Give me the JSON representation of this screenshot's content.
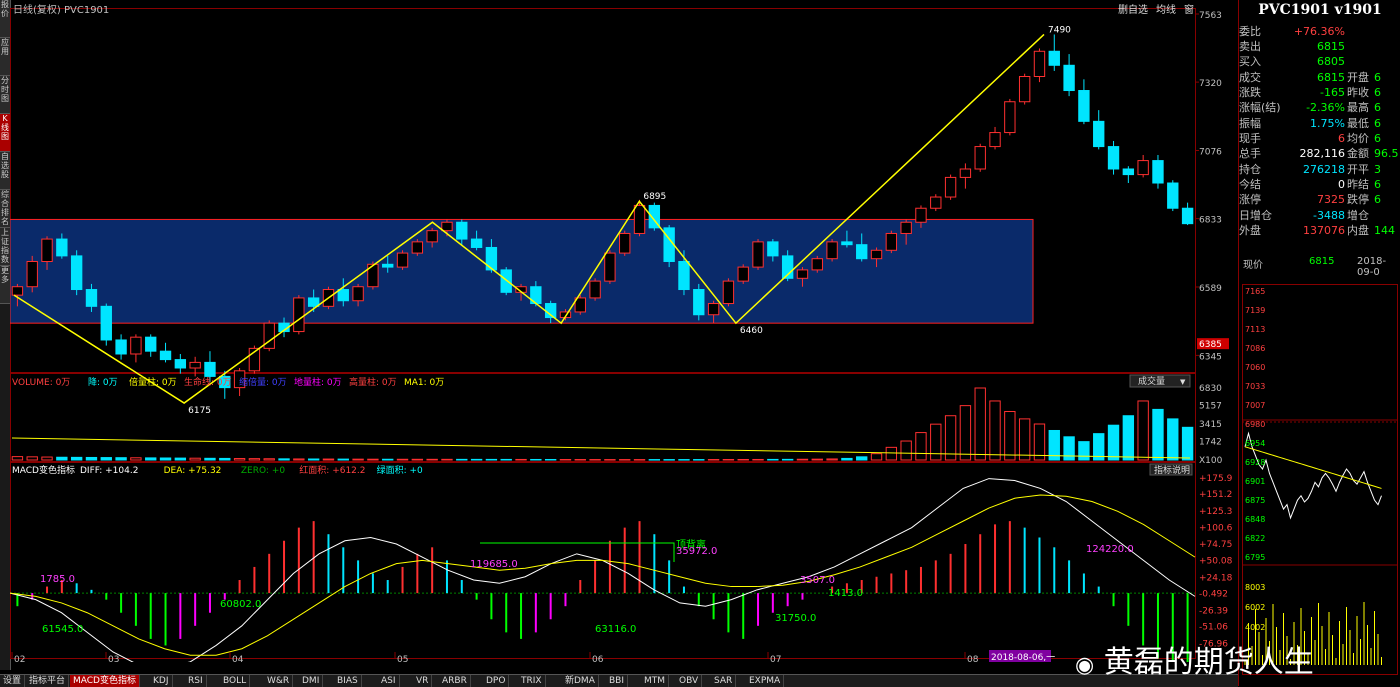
{
  "window": {
    "title": "日线(复权)  PVC1901"
  },
  "toolbar": {
    "items": [
      "删自选",
      "均线",
      "窗"
    ]
  },
  "left_tabs": [
    "报价",
    "应用",
    "分时图",
    "K线图",
    "自选股",
    "综合排名",
    "上证指数",
    "更多"
  ],
  "left_active": 3,
  "bottom_tabs": [
    "设置",
    "指标平台",
    "MACD变色指标",
    "KDJ",
    "RSI",
    "BOLL",
    "W&R",
    "DMI",
    "BIAS",
    "ASI",
    "VR",
    "ARBR",
    "DPO",
    "TRIX",
    "新DMA",
    "BBI",
    "MTM",
    "OBV",
    "SAR",
    "EXPMA"
  ],
  "bottom_active": 2,
  "date_marker": "2018-08-06,一",
  "x_month_labels": [
    "02",
    "03",
    "04",
    "05",
    "06",
    "07",
    "08"
  ],
  "main_price_labels": [
    "7563",
    "7320",
    "7076",
    "6833",
    "6589",
    "6345"
  ],
  "current_price_tag": "6385",
  "volume_panel": {
    "legend": [
      "VOLUME: 0万",
      "降: 0万",
      "倍量柱: 0万",
      "生命线: 0万",
      "缩倍量: 0万",
      "地量柱: 0万",
      "高量柱: 0万",
      "MA1: 0万"
    ],
    "legend_colors": [
      "#ff4040",
      "#00ffff",
      "#ffff00",
      "#ff4040",
      "#4040ff",
      "#ff00ff",
      "#ff4040",
      "#ffff00"
    ],
    "dropdown": "成交量",
    "y_labels": [
      "6830",
      "5157",
      "3415",
      "1742",
      "X100"
    ]
  },
  "macd_panel": {
    "title": "MACD变色指标",
    "legend": [
      "DIFF: +104.2",
      "DEA: +75.32",
      "ZERO: +0",
      "红面积: +612.2",
      "绿面积: +0"
    ],
    "legend_colors": [
      "#ffffff",
      "#ffff00",
      "#00aa00",
      "#ff4040",
      "#00ffff"
    ],
    "help_button": "指标说明",
    "y_labels": [
      "+175.9",
      "+151.2",
      "+125.3",
      "+100.6",
      "+74.75",
      "+50.08",
      "+24.18",
      "-0.492",
      "-26.39",
      "-51.06",
      "-76.96"
    ],
    "annotations": [
      "1785.0",
      "61545.0",
      "60802.0",
      "119685.0",
      "顶背离",
      "35972.0",
      "63116.0",
      "31750.0",
      "3507.0",
      "1413.0",
      "124220.0"
    ]
  },
  "chart_data": {
    "type": "candlestick",
    "title": "PVC1901 日线(复权)",
    "ylim": [
      6300,
      7563
    ],
    "x_months": [
      "02",
      "03",
      "04",
      "05",
      "06",
      "07",
      "08"
    ],
    "zigzag_points": [
      {
        "date_index": 0,
        "price": 6560
      },
      {
        "date_index": 37,
        "price": 6175
      },
      {
        "date_index": 91,
        "price": 6820
      },
      {
        "date_index": 119,
        "price": 6460
      },
      {
        "date_index": 136,
        "price": 6895
      },
      {
        "date_index": 157,
        "price": 6460
      },
      {
        "date_index": 224,
        "price": 7490
      }
    ],
    "pivot_labels": [
      "6175",
      "6895",
      "6460",
      "7490"
    ],
    "box_range": [
      6460,
      6830
    ],
    "candles": [
      [
        6560,
        6600,
        6520,
        6590
      ],
      [
        6590,
        6700,
        6570,
        6680
      ],
      [
        6680,
        6770,
        6650,
        6760
      ],
      [
        6760,
        6780,
        6690,
        6700
      ],
      [
        6700,
        6720,
        6560,
        6580
      ],
      [
        6580,
        6600,
        6500,
        6520
      ],
      [
        6520,
        6530,
        6380,
        6400
      ],
      [
        6400,
        6420,
        6330,
        6350
      ],
      [
        6350,
        6420,
        6320,
        6410
      ],
      [
        6410,
        6420,
        6340,
        6360
      ],
      [
        6360,
        6390,
        6320,
        6330
      ],
      [
        6330,
        6350,
        6280,
        6300
      ],
      [
        6300,
        6340,
        6270,
        6320
      ],
      [
        6320,
        6360,
        6250,
        6270
      ],
      [
        6270,
        6290,
        6190,
        6230
      ],
      [
        6230,
        6300,
        6200,
        6290
      ],
      [
        6290,
        6380,
        6280,
        6370
      ],
      [
        6370,
        6470,
        6360,
        6460
      ],
      [
        6460,
        6480,
        6410,
        6430
      ],
      [
        6430,
        6560,
        6420,
        6550
      ],
      [
        6550,
        6580,
        6500,
        6520
      ],
      [
        6520,
        6590,
        6510,
        6580
      ],
      [
        6580,
        6620,
        6520,
        6540
      ],
      [
        6540,
        6600,
        6520,
        6590
      ],
      [
        6590,
        6680,
        6580,
        6670
      ],
      [
        6670,
        6700,
        6640,
        6660
      ],
      [
        6660,
        6720,
        6650,
        6710
      ],
      [
        6710,
        6760,
        6700,
        6750
      ],
      [
        6750,
        6800,
        6730,
        6790
      ],
      [
        6790,
        6830,
        6770,
        6820
      ],
      [
        6820,
        6830,
        6740,
        6760
      ],
      [
        6760,
        6790,
        6720,
        6730
      ],
      [
        6730,
        6760,
        6640,
        6650
      ],
      [
        6650,
        6660,
        6560,
        6570
      ],
      [
        6570,
        6600,
        6540,
        6590
      ],
      [
        6590,
        6610,
        6520,
        6530
      ],
      [
        6530,
        6540,
        6460,
        6480
      ],
      [
        6480,
        6510,
        6470,
        6500
      ],
      [
        6500,
        6560,
        6490,
        6550
      ],
      [
        6550,
        6620,
        6540,
        6610
      ],
      [
        6610,
        6720,
        6600,
        6710
      ],
      [
        6710,
        6790,
        6700,
        6780
      ],
      [
        6780,
        6900,
        6770,
        6880
      ],
      [
        6880,
        6890,
        6790,
        6800
      ],
      [
        6800,
        6810,
        6660,
        6680
      ],
      [
        6680,
        6720,
        6560,
        6580
      ],
      [
        6580,
        6600,
        6470,
        6490
      ],
      [
        6490,
        6540,
        6460,
        6530
      ],
      [
        6530,
        6620,
        6520,
        6610
      ],
      [
        6610,
        6670,
        6600,
        6660
      ],
      [
        6660,
        6760,
        6650,
        6750
      ],
      [
        6750,
        6760,
        6680,
        6700
      ],
      [
        6700,
        6720,
        6610,
        6620
      ],
      [
        6620,
        6660,
        6590,
        6650
      ],
      [
        6650,
        6700,
        6640,
        6690
      ],
      [
        6690,
        6760,
        6680,
        6750
      ],
      [
        6750,
        6790,
        6730,
        6740
      ],
      [
        6740,
        6780,
        6680,
        6690
      ],
      [
        6690,
        6730,
        6660,
        6720
      ],
      [
        6720,
        6790,
        6710,
        6780
      ],
      [
        6780,
        6830,
        6740,
        6820
      ],
      [
        6820,
        6880,
        6800,
        6870
      ],
      [
        6870,
        6920,
        6860,
        6910
      ],
      [
        6910,
        6990,
        6900,
        6980
      ],
      [
        6980,
        7030,
        6940,
        7010
      ],
      [
        7010,
        7100,
        7000,
        7090
      ],
      [
        7090,
        7160,
        7080,
        7140
      ],
      [
        7140,
        7260,
        7130,
        7250
      ],
      [
        7250,
        7350,
        7240,
        7340
      ],
      [
        7340,
        7440,
        7320,
        7430
      ],
      [
        7430,
        7490,
        7360,
        7380
      ],
      [
        7380,
        7420,
        7270,
        7290
      ],
      [
        7290,
        7330,
        7170,
        7180
      ],
      [
        7180,
        7220,
        7080,
        7090
      ],
      [
        7090,
        7110,
        6990,
        7010
      ],
      [
        7010,
        7020,
        6960,
        6990
      ],
      [
        6990,
        7060,
        6980,
        7040
      ],
      [
        7040,
        7060,
        6940,
        6960
      ],
      [
        6960,
        6970,
        6860,
        6870
      ],
      [
        6870,
        6890,
        6810,
        6815
      ]
    ],
    "volumes": [
      320,
      300,
      280,
      260,
      250,
      240,
      230,
      220,
      210,
      200,
      190,
      180,
      170,
      160,
      150,
      140,
      130,
      120,
      110,
      100,
      95,
      90,
      85,
      80,
      75,
      70,
      68,
      66,
      64,
      62,
      60,
      58,
      56,
      54,
      52,
      50,
      48,
      46,
      44,
      42,
      40,
      40,
      40,
      40,
      40,
      40,
      42,
      44,
      46,
      48,
      50,
      55,
      60,
      70,
      80,
      100,
      150,
      300,
      600,
      1200,
      1800,
      2600,
      3400,
      4200,
      5157,
      6830,
      5600,
      4600,
      3900,
      3415,
      2800,
      2200,
      1742,
      2500,
      3300,
      4200,
      5600,
      4800,
      3900,
      3100
    ],
    "macd_hist": [
      -20,
      -10,
      10,
      20,
      15,
      5,
      -10,
      -30,
      -50,
      -70,
      -80,
      -70,
      -50,
      -30,
      -10,
      20,
      40,
      60,
      80,
      100,
      110,
      90,
      70,
      50,
      30,
      20,
      40,
      60,
      70,
      50,
      20,
      -10,
      -40,
      -60,
      -70,
      -60,
      -40,
      -20,
      20,
      50,
      80,
      100,
      110,
      90,
      50,
      10,
      -20,
      -40,
      -60,
      -70,
      -50,
      -30,
      -20,
      -10,
      0,
      10,
      15,
      20,
      25,
      30,
      35,
      40,
      50,
      60,
      75,
      90,
      105,
      110,
      100,
      85,
      70,
      50,
      30,
      10,
      -20,
      -50,
      -80,
      -100,
      -120,
      -140
    ],
    "macd_diff": [
      0,
      -10,
      -30,
      -60,
      -90,
      -110,
      -115,
      -105,
      -80,
      -50,
      -10,
      30,
      60,
      80,
      85,
      75,
      55,
      35,
      20,
      15,
      25,
      45,
      60,
      50,
      30,
      5,
      -15,
      -20,
      -10,
      5,
      15,
      25,
      40,
      60,
      80,
      100,
      130,
      160,
      175,
      172,
      160,
      140,
      110,
      80,
      50,
      20,
      -5
    ],
    "macd_dea": [
      0,
      -5,
      -15,
      -30,
      -50,
      -70,
      -85,
      -95,
      -95,
      -85,
      -65,
      -40,
      -15,
      10,
      30,
      45,
      50,
      45,
      40,
      35,
      38,
      45,
      50,
      50,
      45,
      35,
      25,
      15,
      10,
      10,
      12,
      18,
      28,
      40,
      55,
      70,
      90,
      110,
      130,
      145,
      150,
      148,
      140,
      125,
      105,
      80,
      55
    ]
  }
}
